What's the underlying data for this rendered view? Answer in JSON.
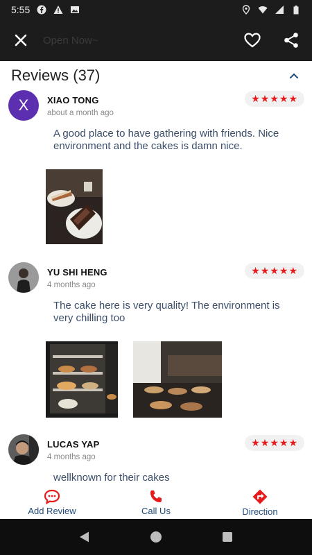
{
  "status_bar": {
    "time": "5:55"
  },
  "app_bar": {
    "subtitle": "Open Now~"
  },
  "reviews": {
    "title": "Reviews (37)",
    "items": [
      {
        "initial": "X",
        "name": "XIAO TONG",
        "time": "about a month ago",
        "stars": "★★★★★",
        "text": "A good place to have gathering with friends. Nice environment and the cakes is damn nice."
      },
      {
        "name": "YU SHI HENG",
        "time": "4 months ago",
        "stars": "★★★★★",
        "text": "The cake here is very quality! The environment is very chilling too"
      },
      {
        "name": "LUCAS YAP",
        "time": "4 months ago",
        "stars": "★★★★★",
        "text": "wellknown for their cakes"
      }
    ]
  },
  "bottom_actions": {
    "add_review": "Add Review",
    "call_us": "Call Us",
    "direction": "Direction"
  },
  "colors": {
    "accent_red": "#e61a1a",
    "text_blue": "#3b4e6a",
    "label_blue": "#1f4b7a",
    "avatar_purple": "#5b2fb0",
    "dark_bar": "#1c1c1c"
  },
  "icons": [
    "close-icon",
    "heart-icon",
    "share-icon",
    "chevron-up-icon",
    "chat-icon",
    "phone-icon",
    "direction-icon",
    "back-icon",
    "home-icon",
    "recents-icon"
  ]
}
